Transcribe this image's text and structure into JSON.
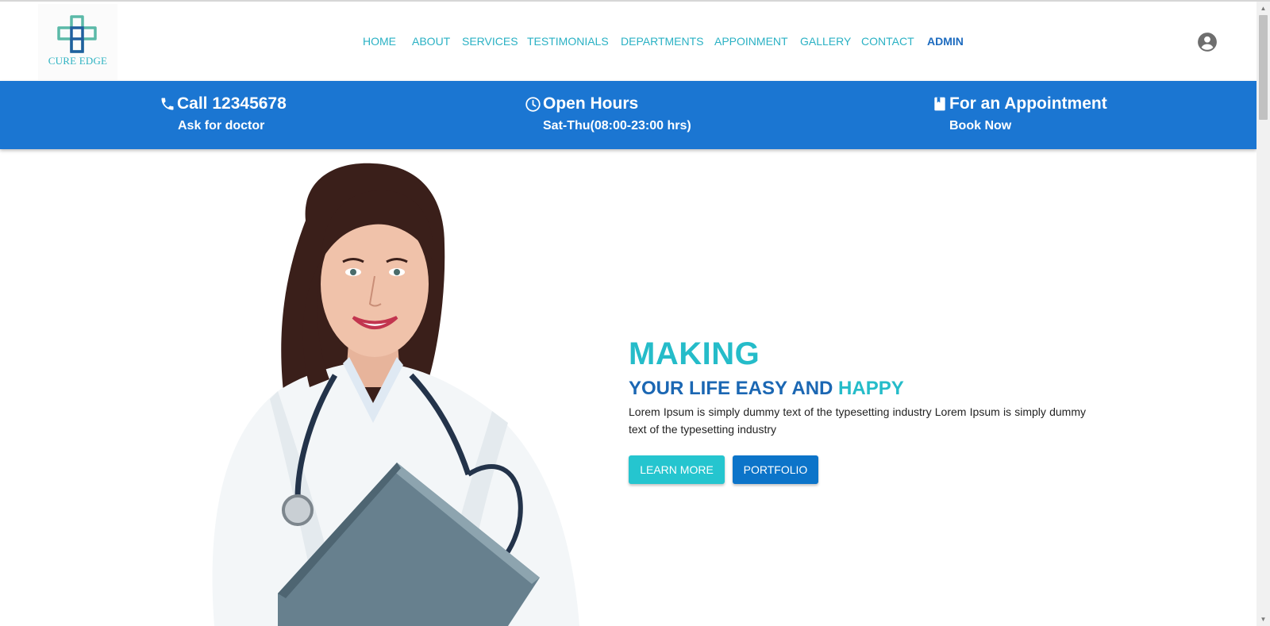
{
  "brand": {
    "logo_text": "CURE EDGE",
    "colors": {
      "primary_teal": "#25bcc9",
      "primary_blue": "#1b76d2",
      "dark_blue": "#1b67b3"
    }
  },
  "nav": {
    "items": [
      {
        "label": "HOME"
      },
      {
        "label": "ABOUT"
      },
      {
        "label": "SERVICES"
      },
      {
        "label": "TESTIMONIALS"
      },
      {
        "label": "DEPARTMENTS"
      },
      {
        "label": "APPOINMENT"
      },
      {
        "label": "GALLERY"
      },
      {
        "label": "CONTACT"
      },
      {
        "label": "ADMIN"
      }
    ],
    "user_icon": "account-circle-icon"
  },
  "info_bar": {
    "call": {
      "icon": "phone-icon",
      "title": "Call 12345678",
      "subtitle": "Ask for doctor"
    },
    "hours": {
      "icon": "clock-icon",
      "title": "Open Hours",
      "subtitle": "Sat-Thu(08:00-23:00 hrs)"
    },
    "appointment": {
      "icon": "book-icon",
      "title": "For an Appointment",
      "subtitle": "Book Now"
    }
  },
  "hero": {
    "title": "MAKING",
    "subtitle_main": "YOUR LIFE EASY AND",
    "subtitle_accent": "HAPPY",
    "description": "Lorem Ipsum is simply dummy text of the typesetting industry Lorem Ipsum is simply dummy text of the typesetting industry",
    "buttons": {
      "learn_more": "LEARN MORE",
      "portfolio": "PORTFOLIO"
    }
  }
}
